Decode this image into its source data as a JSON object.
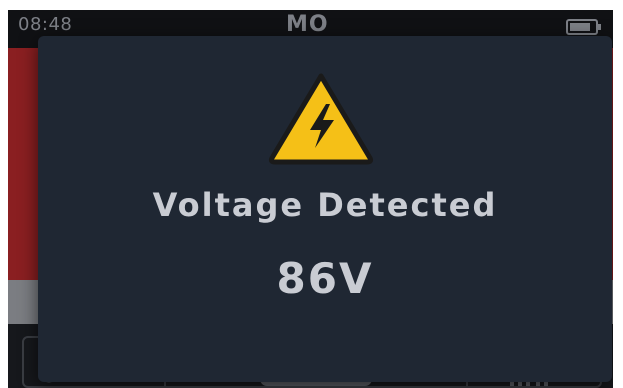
{
  "status_bar": {
    "time": "08:48",
    "mode": "MO",
    "battery_icon": "battery-icon"
  },
  "alert": {
    "icon": "high-voltage-warning-icon",
    "title": "Voltage Detected",
    "value": "86V",
    "icon_color": "#f5c017"
  },
  "softkeys": {
    "left_icon": "settings-icon",
    "right_icon": "graph-icon"
  },
  "colors": {
    "background_alert": "#8a1f21",
    "modal": "#1f2733",
    "text": "#c9ccd3"
  }
}
